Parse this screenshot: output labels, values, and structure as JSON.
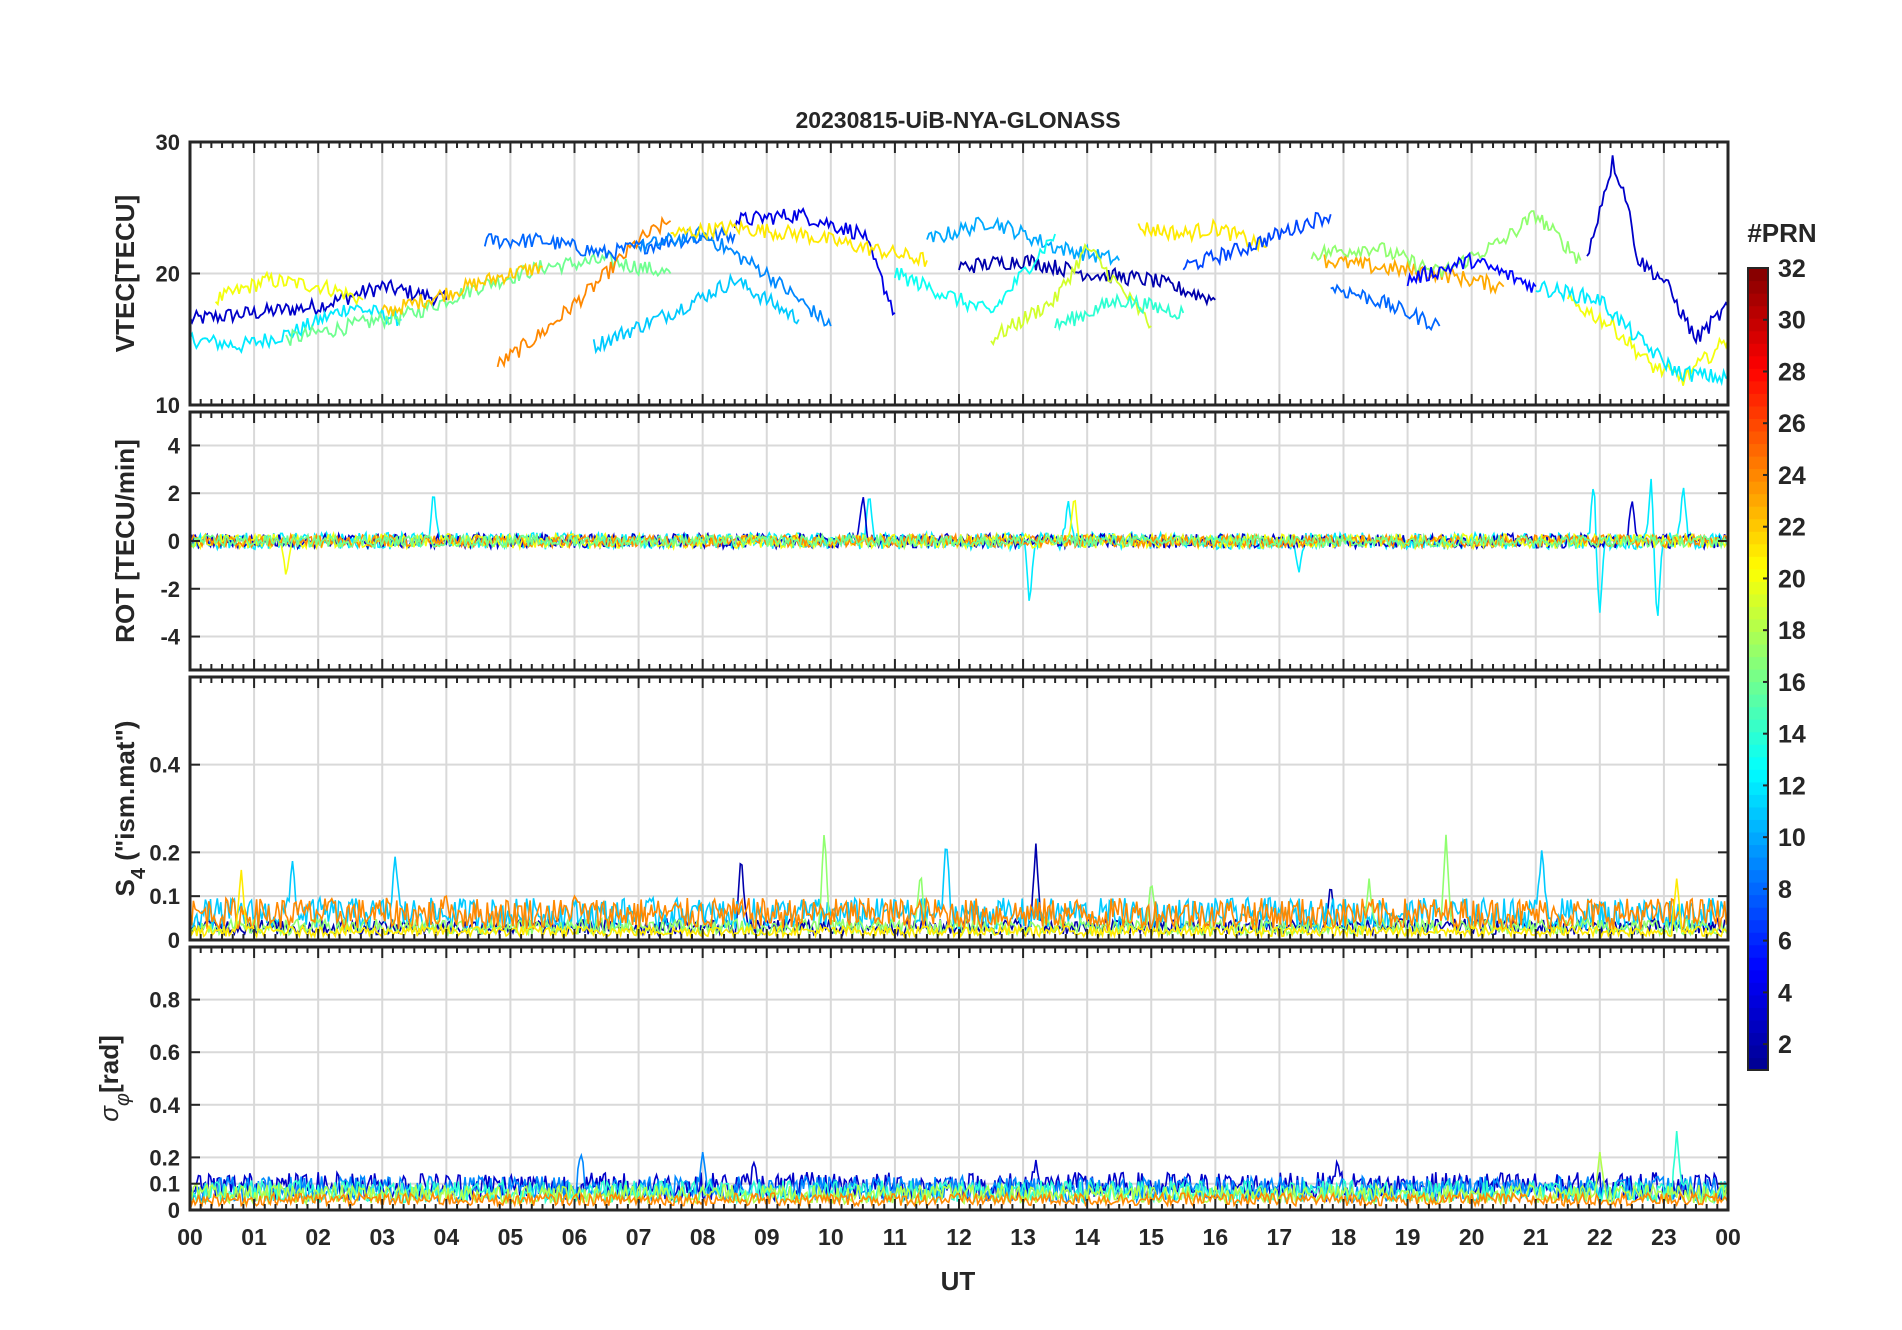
{
  "colors": {
    "axis": "#262626",
    "grid": "#d9d9d9",
    "colormap": "jet",
    "colormap_stops": [
      "#00008f",
      "#0000ff",
      "#00ffff",
      "#ffff00",
      "#ff0000",
      "#800000"
    ]
  },
  "chart_data": {
    "type": "line",
    "title": "20230815-UiB-NYA-GLONASS",
    "xlabel": "UT",
    "x_ticks": [
      "00",
      "01",
      "02",
      "03",
      "04",
      "05",
      "06",
      "07",
      "08",
      "09",
      "10",
      "11",
      "12",
      "13",
      "14",
      "15",
      "16",
      "17",
      "18",
      "19",
      "20",
      "21",
      "22",
      "23",
      "00"
    ],
    "xlim": [
      0,
      24
    ],
    "x_unit": "hours UT",
    "colorbar": {
      "title": "#PRN",
      "range": [
        1,
        32
      ],
      "ticks": [
        2,
        4,
        6,
        8,
        10,
        12,
        14,
        16,
        18,
        20,
        22,
        24,
        26,
        28,
        30,
        32
      ],
      "colormap": "jet"
    },
    "panels": [
      {
        "id": "vtec",
        "ylabel": "VTEC[TECU]",
        "ylim": [
          10,
          30
        ],
        "yticks": [
          10,
          20,
          30
        ],
        "grid": true,
        "series": [
          {
            "prn": 3,
            "x": [
              0,
              1,
              2,
              3,
              4
            ],
            "y": [
              16.5,
              17,
              17.5,
              19,
              18
            ]
          },
          {
            "prn": 12,
            "x": [
              0,
              0.8,
              1.6,
              2.5,
              3.3
            ],
            "y": [
              15,
              14.5,
              15.5,
              17.5,
              16.5
            ]
          },
          {
            "prn": 20,
            "x": [
              0.4,
              1.2,
              2.1,
              2.7
            ],
            "y": [
              18,
              19.5,
              19,
              18
            ]
          },
          {
            "prn": 16,
            "x": [
              1.5,
              2.5,
              3.5,
              4.5,
              5.5,
              6.5,
              7.5
            ],
            "y": [
              15,
              16,
              17,
              19,
              20.5,
              21,
              20
            ]
          },
          {
            "prn": 22,
            "x": [
              3,
              4,
              5,
              5.5
            ],
            "y": [
              17,
              18.5,
              20,
              20.5
            ]
          },
          {
            "prn": 24,
            "x": [
              4.8,
              5.5,
              6.3,
              7,
              7.5
            ],
            "y": [
              13,
              15.5,
              19,
              22.5,
              24
            ]
          },
          {
            "prn": 8,
            "x": [
              4.6,
              5.5,
              6.5,
              7.5,
              8.5
            ],
            "y": [
              22.5,
              22.5,
              21.5,
              22.5,
              23
            ]
          },
          {
            "prn": 11,
            "x": [
              6.3,
              7.5,
              8.5,
              9.5
            ],
            "y": [
              14.5,
              17,
              19.5,
              16.5
            ]
          },
          {
            "prn": 4,
            "x": [
              8.5,
              9.5,
              10.5,
              11
            ],
            "y": [
              24,
              24.5,
              23,
              17
            ]
          },
          {
            "prn": 9,
            "x": [
              7,
              8,
              9,
              10
            ],
            "y": [
              22,
              23,
              20,
              16
            ]
          },
          {
            "prn": 21,
            "x": [
              7.5,
              8.5,
              9.5,
              10.5,
              11.5
            ],
            "y": [
              23,
              23.5,
              23,
              22,
              21
            ]
          },
          {
            "prn": 10,
            "x": [
              11.5,
              12.5,
              13.5,
              14.5
            ],
            "y": [
              22.5,
              24,
              22,
              21
            ]
          },
          {
            "prn": 2,
            "x": [
              12,
              13,
              14,
              15,
              16
            ],
            "y": [
              20.5,
              21,
              20,
              19.5,
              18
            ]
          },
          {
            "prn": 19,
            "x": [
              12.5,
              13.5,
              14,
              15
            ],
            "y": [
              15,
              18,
              22,
              16
            ]
          },
          {
            "prn": 13,
            "x": [
              11,
              12.5,
              13.5
            ],
            "y": [
              20,
              17,
              23
            ]
          },
          {
            "prn": 14,
            "x": [
              13.5,
              14.5,
              15.5
            ],
            "y": [
              16,
              18,
              17
            ]
          },
          {
            "prn": 21,
            "x": [
              14.8,
              15.5,
              16,
              16.8
            ],
            "y": [
              23.5,
              23,
              23.5,
              22
            ]
          },
          {
            "prn": 7,
            "x": [
              15.5,
              16.5,
              17.5,
              17.8
            ],
            "y": [
              20.5,
              22,
              24,
              24.5
            ]
          },
          {
            "prn": 23,
            "x": [
              17.7,
              18.5,
              19.5,
              20.5
            ],
            "y": [
              21,
              20.5,
              20,
              19
            ]
          },
          {
            "prn": 17,
            "x": [
              17.5,
              18.5,
              19.5,
              20.5,
              21,
              21.7
            ],
            "y": [
              21.5,
              22,
              20,
              22.5,
              24.5,
              21
            ]
          },
          {
            "prn": 8,
            "x": [
              17.8,
              18.5,
              19.5
            ],
            "y": [
              19,
              18,
              16
            ]
          },
          {
            "prn": 5,
            "x": [
              19,
              20,
              21
            ],
            "y": [
              19.5,
              21,
              19
            ]
          },
          {
            "prn": 3,
            "x": [
              21.8,
              22,
              22.2,
              22.4,
              22.6,
              23,
              23.5,
              24
            ],
            "y": [
              21,
              25,
              28.5,
              26,
              21,
              19.5,
              15,
              17.5
            ]
          },
          {
            "prn": 20,
            "x": [
              21.5,
              22.2,
              22.8,
              23.3,
              24
            ],
            "y": [
              18,
              16,
              13,
              12,
              15
            ]
          },
          {
            "prn": 12,
            "x": [
              21,
              22,
              22.6,
              23.2,
              24
            ],
            "y": [
              19,
              18,
              15,
              12.5,
              12
            ]
          }
        ]
      },
      {
        "id": "rot",
        "ylabel": "ROT [TECU/min]",
        "ylim": [
          -5.4,
          5.4
        ],
        "yticks": [
          -4,
          -2,
          0,
          2,
          4
        ],
        "grid": true,
        "series": [
          {
            "prn": 12,
            "noise": 0.35,
            "spikes": [
              [
                3.8,
                2.2
              ],
              [
                10.6,
                2.1
              ],
              [
                13.1,
                -2.7
              ],
              [
                13.7,
                1.8
              ],
              [
                17.3,
                -1.4
              ],
              [
                21.9,
                2.4
              ],
              [
                22,
                -3.0
              ],
              [
                22.8,
                2.6
              ],
              [
                22.9,
                -3.4
              ],
              [
                23.3,
                2.4
              ]
            ]
          },
          {
            "prn": 3,
            "noise": 0.3,
            "spikes": [
              [
                10.5,
                2.0
              ],
              [
                22.5,
                1.8
              ]
            ]
          },
          {
            "prn": 20,
            "noise": 0.3,
            "spikes": [
              [
                1.5,
                -1.5
              ],
              [
                13.8,
                2.0
              ]
            ]
          },
          {
            "prn": 24,
            "noise": 0.25,
            "spikes": []
          },
          {
            "prn": 16,
            "noise": 0.25,
            "spikes": []
          }
        ]
      },
      {
        "id": "s4",
        "ylabel": "S4 (\"ism.mat\")",
        "ylim": [
          0,
          0.6
        ],
        "yticks": [
          0,
          0.1,
          0.2,
          0.4
        ],
        "grid": true,
        "series": [
          {
            "prn": 2,
            "base": 0.03,
            "spikes": [
              [
                8.6,
                0.2
              ],
              [
                13.2,
                0.22
              ],
              [
                17.8,
                0.13
              ]
            ]
          },
          {
            "prn": 11,
            "base": 0.06,
            "spikes": [
              [
                1.6,
                0.18
              ],
              [
                3.2,
                0.19
              ],
              [
                11.8,
                0.23
              ],
              [
                21.1,
                0.22
              ]
            ]
          },
          {
            "prn": 17,
            "base": 0.03,
            "spikes": [
              [
                9.9,
                0.26
              ],
              [
                11.4,
                0.16
              ],
              [
                15,
                0.14
              ],
              [
                18.4,
                0.14
              ],
              [
                19.6,
                0.24
              ]
            ]
          },
          {
            "prn": 24,
            "base": 0.06,
            "spikes": [
              [
                4,
                0.1
              ],
              [
                6,
                0.1
              ]
            ]
          },
          {
            "prn": 21,
            "base": 0.02,
            "spikes": [
              [
                0.8,
                0.16
              ],
              [
                23.2,
                0.14
              ]
            ]
          }
        ]
      },
      {
        "id": "sigma",
        "ylabel": "σφ[rad]",
        "ylim": [
          0,
          1
        ],
        "yticks": [
          0,
          0.1,
          0.2,
          0.4,
          0.6,
          0.8
        ],
        "grid": true,
        "series": [
          {
            "prn": 3,
            "base": 0.09,
            "spikes": [
              [
                8.8,
                0.18
              ],
              [
                13.2,
                0.19
              ],
              [
                17.9,
                0.19
              ]
            ]
          },
          {
            "prn": 9,
            "base": 0.08,
            "spikes": [
              [
                6.1,
                0.22
              ],
              [
                8,
                0.22
              ]
            ]
          },
          {
            "prn": 14,
            "base": 0.07,
            "spikes": [
              [
                23.2,
                0.3
              ]
            ]
          },
          {
            "prn": 18,
            "base": 0.06,
            "spikes": [
              [
                22,
                0.22
              ]
            ]
          },
          {
            "prn": 24,
            "base": 0.04,
            "spikes": []
          }
        ]
      }
    ]
  }
}
